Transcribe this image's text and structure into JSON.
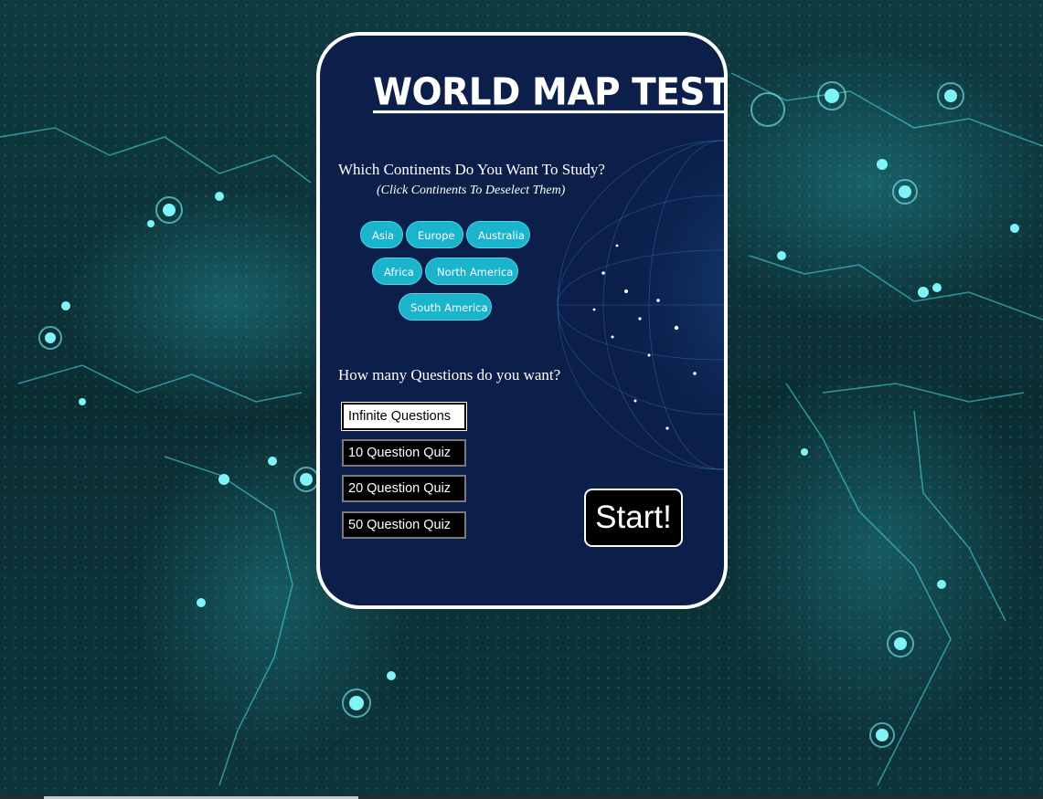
{
  "app": {
    "title": "WORLD MAP TEST"
  },
  "continents": {
    "question": "Which Continents Do You Want To Study?",
    "hint": "(Click Continents To Deselect Them)",
    "items": [
      {
        "label": "Asia",
        "selected": true
      },
      {
        "label": "Europe",
        "selected": true
      },
      {
        "label": "Australia",
        "selected": true
      },
      {
        "label": "Africa",
        "selected": true
      },
      {
        "label": "North America",
        "selected": true
      },
      {
        "label": "South America",
        "selected": true
      }
    ]
  },
  "questions": {
    "question": "How many Questions do you want?",
    "options": [
      {
        "label": "Infinite Questions",
        "selected": true
      },
      {
        "label": "10 Question Quiz",
        "selected": false
      },
      {
        "label": "20 Question Quiz",
        "selected": false
      },
      {
        "label": "50 Question Quiz",
        "selected": false
      }
    ]
  },
  "start": {
    "label": "Start!"
  },
  "colors": {
    "card_background": "#0b1f4a",
    "pill": "#1ab4cc",
    "map_glow": "#3fe0e8"
  }
}
